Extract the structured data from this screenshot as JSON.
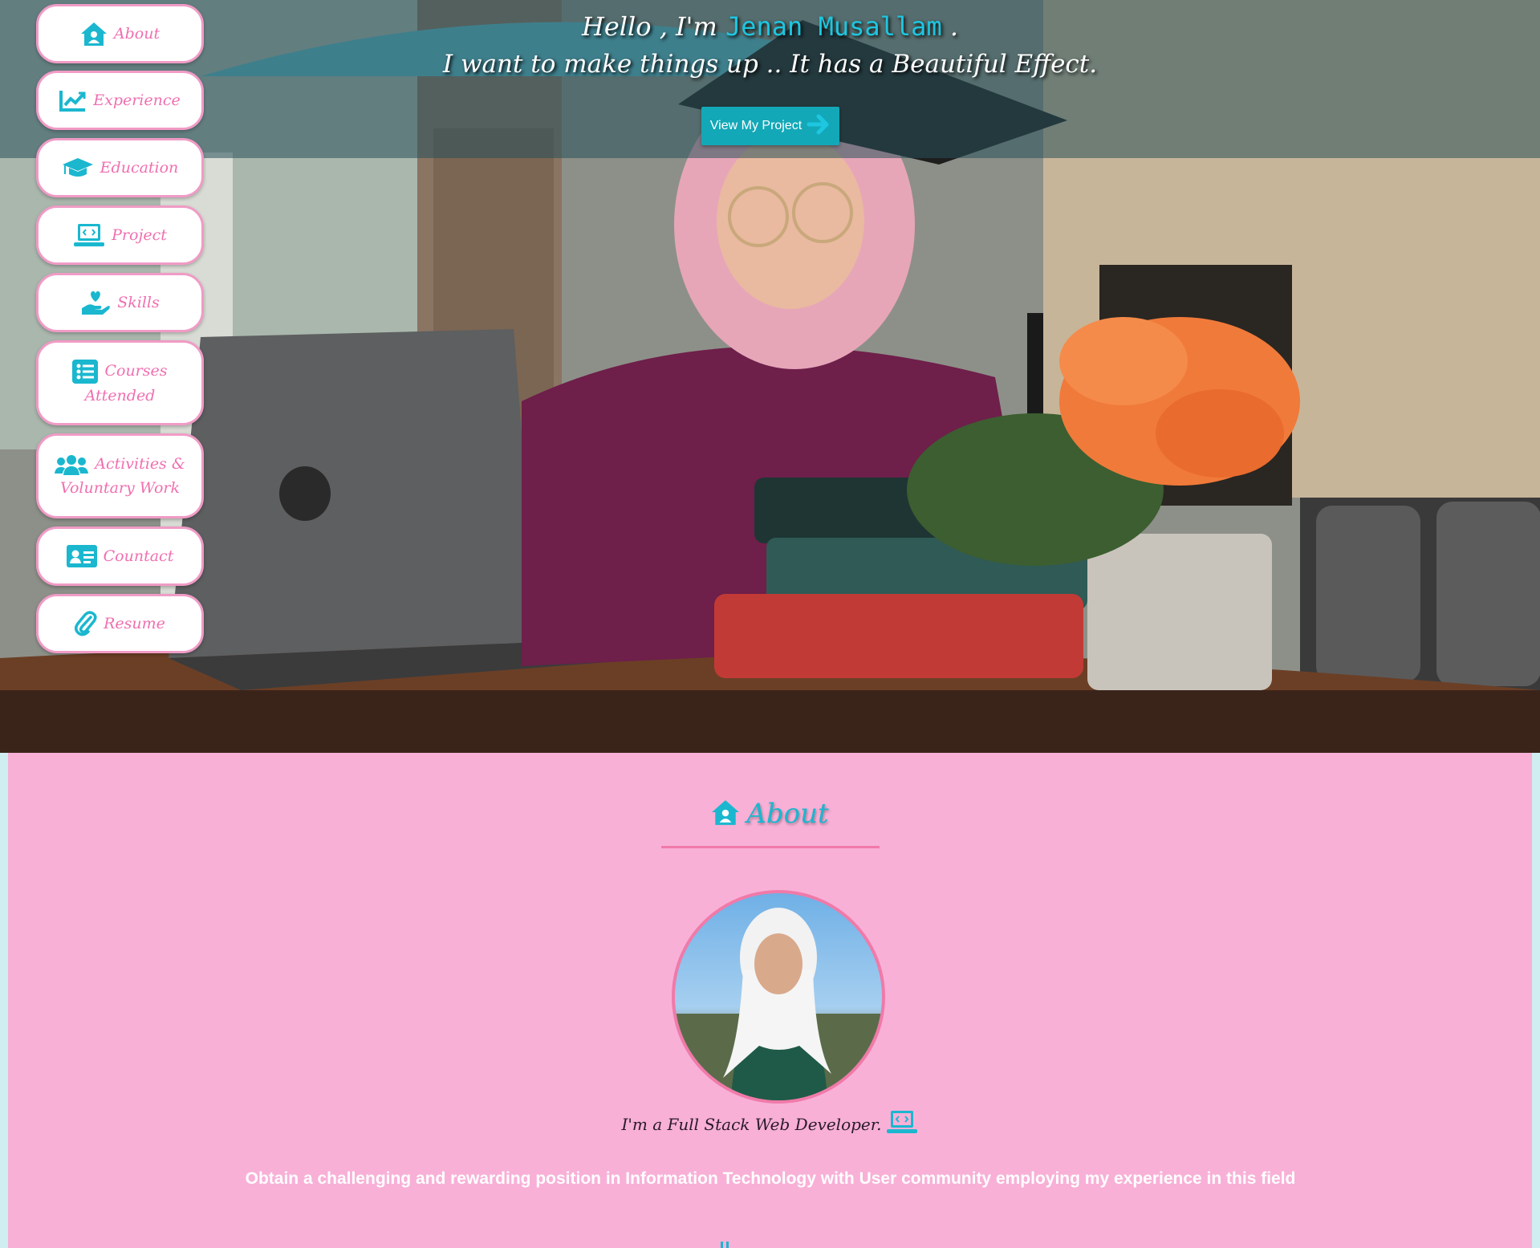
{
  "hero": {
    "greeting": "Hello , I'm ",
    "name": "Jenan Musallam",
    "greeting_end": " .",
    "subtitle": "I want to make things up .. It has a Beautiful Effect.",
    "cta_label": "View My Project",
    "cta_icon": "arrow-right-icon"
  },
  "nav": {
    "items": [
      {
        "id": "about",
        "label": "About",
        "icon": "house-user-icon"
      },
      {
        "id": "experience",
        "label": "Experience",
        "icon": "chart-line-icon"
      },
      {
        "id": "education",
        "label": "Education",
        "icon": "graduation-cap-icon"
      },
      {
        "id": "project",
        "label": "Project",
        "icon": "laptop-code-icon"
      },
      {
        "id": "skills",
        "label": "Skills",
        "icon": "hand-holding-heart-icon"
      },
      {
        "id": "courses",
        "label": "Courses Attended",
        "icon": "list-icon"
      },
      {
        "id": "activities",
        "label": "Activities & Voluntary Work",
        "icon": "users-icon"
      },
      {
        "id": "contact",
        "label": "Countact",
        "icon": "address-card-icon"
      },
      {
        "id": "resume",
        "label": "Resume",
        "icon": "paperclip-icon"
      }
    ]
  },
  "about": {
    "title": "About",
    "title_icon": "house-user-icon",
    "tagline": "I'm a Full Stack Web Developer.",
    "tagline_icon": "laptop-code-icon",
    "objective": "Obtain a challenging and rewarding position in Information Technology with User community employing my experience in this field"
  },
  "colors": {
    "accent_cyan": "#1ab7cf",
    "accent_pink": "#f06fb0",
    "section_bg": "#f8b0d7",
    "button_teal": "#13a8b8"
  }
}
